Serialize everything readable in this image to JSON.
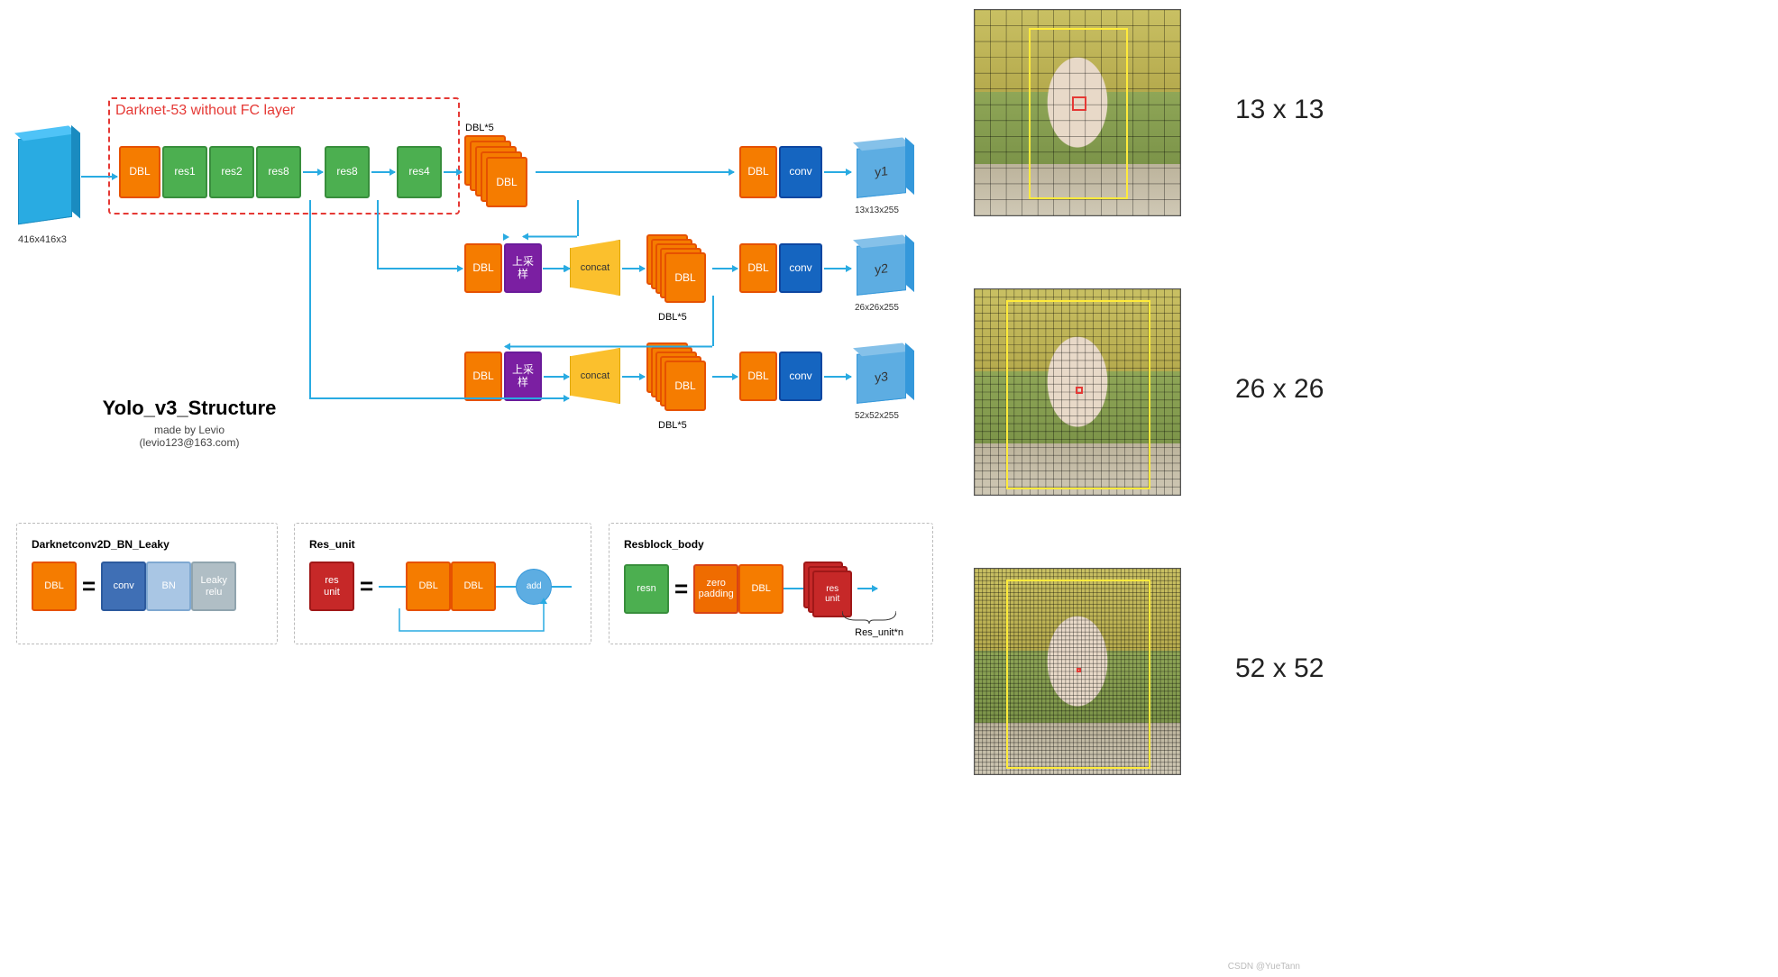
{
  "diagram": {
    "input_label": "416x416x3",
    "darknet_label": "Darknet-53 without FC layer",
    "row1": {
      "dbl": "DBL",
      "res1": "res1",
      "res2": "res2",
      "res8a": "res8",
      "res8b": "res8",
      "res4": "res4"
    },
    "dbl5_label": "DBL*5",
    "upsample": "上采\n样",
    "concat": "concat",
    "dbl": "DBL",
    "conv": "conv",
    "outputs": {
      "y1": {
        "name": "y1",
        "dim": "13x13x255"
      },
      "y2": {
        "name": "y2",
        "dim": "26x26x255"
      },
      "y3": {
        "name": "y3",
        "dim": "52x52x255"
      }
    },
    "title": {
      "main": "Yolo_v3_Structure",
      "sub": "made by Levio",
      "mail": "(levio123@163.com)"
    }
  },
  "legend": {
    "dbl": {
      "title": "Darknetconv2D_BN_Leaky",
      "dbl": "DBL",
      "conv": "conv",
      "bn": "BN",
      "leaky": "Leaky\nrelu"
    },
    "res": {
      "title": "Res_unit",
      "resunit": "res\nunit",
      "dbl": "DBL",
      "add": "add"
    },
    "resblock": {
      "title": "Resblock_body",
      "resn": "resn",
      "zero": "zero\npadding",
      "dbl": "DBL",
      "resunit": "res\nunit",
      "note": "Res_unit*n"
    }
  },
  "right": {
    "g1": "13 x 13",
    "g2": "26 x 26",
    "g3": "52 x 52"
  },
  "watermark": "CSDN @YueTann"
}
